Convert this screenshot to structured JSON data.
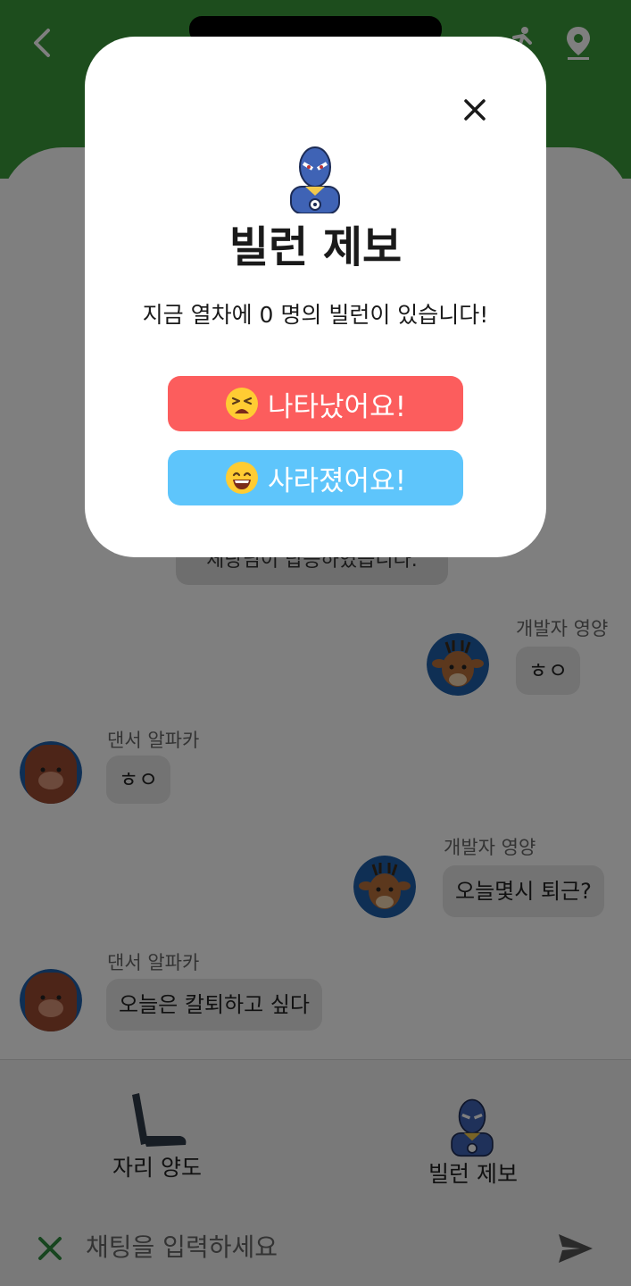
{
  "app": {
    "system_message": "체랑님이 탑승하였습니다."
  },
  "header": {
    "back_icon": "chevron-left-icon",
    "walk_icon": "walking-person-icon",
    "location_icon": "map-pin-icon"
  },
  "messages": [
    {
      "sender": "개발자 영양",
      "text": "ㅎㅇ",
      "side": "right",
      "avatar": "deer-avatar"
    },
    {
      "sender": "댄서 알파카",
      "text": "ㅎㅇ",
      "side": "left",
      "avatar": "alpaca-avatar"
    },
    {
      "sender": "개발자 영양",
      "text": "오늘몇시 퇴근?",
      "side": "right",
      "avatar": "deer-avatar"
    },
    {
      "sender": "댄서 알파카",
      "text": "오늘은 칼퇴하고 싶다",
      "side": "left",
      "avatar": "alpaca-avatar"
    }
  ],
  "bottom_actions": {
    "seat_label": "자리 양도",
    "villain_label": "빌런 제보"
  },
  "chat_input": {
    "placeholder": "채팅을 입력하세요"
  },
  "modal": {
    "title": "빌런 제보",
    "message": "지금 열차에 0 명의 빌런이 있습니다!",
    "appeared_label": "나타났어요!",
    "disappeared_label": "사라졌어요!"
  },
  "colors": {
    "header_green": "#3a9a3a",
    "appeared_button": "#fc5d5d",
    "disappeared_button": "#5ec5fb",
    "send_icon": "#555555",
    "close_icon_green": "#2e8b3e"
  }
}
